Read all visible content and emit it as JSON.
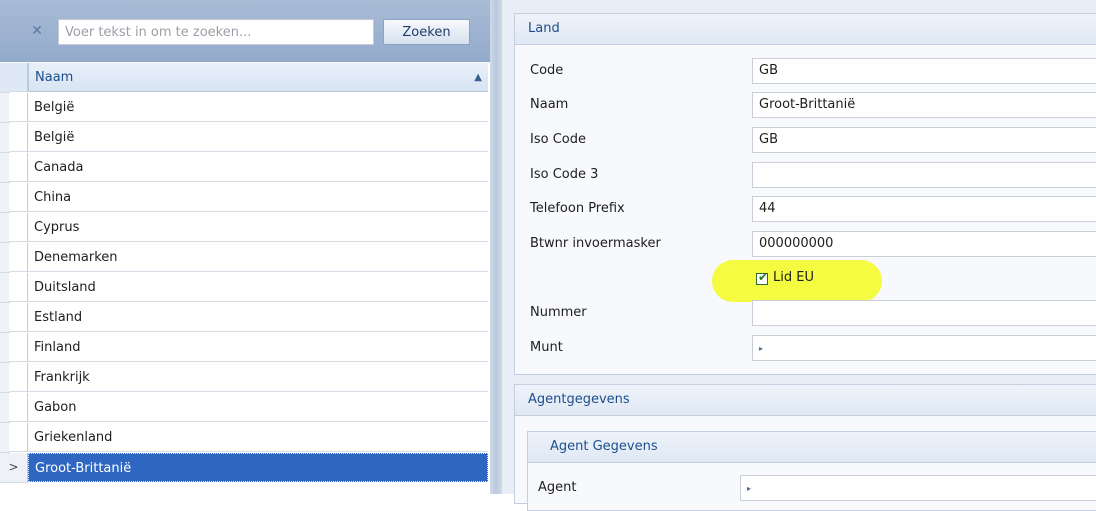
{
  "search": {
    "placeholder": "Voer tekst in om te zoeken...",
    "value": "",
    "clear_icon": "✕",
    "button_label": "Zoeken"
  },
  "grid": {
    "column_header": "Naam",
    "sort_icon": "▲",
    "selected_marker": ">",
    "rows": [
      "België",
      "België",
      "Canada",
      "China",
      "Cyprus",
      "Denemarken",
      "Duitsland",
      "Estland",
      "Finland",
      "Frankrijk",
      "Gabon",
      "Griekenland",
      "Groot-Brittanië"
    ],
    "selected_row": "Groot-Brittanië"
  },
  "land": {
    "title": "Land",
    "fields": {
      "code": {
        "label": "Code",
        "value": "GB"
      },
      "naam": {
        "label": "Naam",
        "value": "Groot-Brittanië"
      },
      "iso_code": {
        "label": "Iso Code",
        "value": "GB"
      },
      "iso_code3": {
        "label": "Iso Code 3",
        "value": ""
      },
      "telefoon": {
        "label": "Telefoon Prefix",
        "value": "44"
      },
      "btwnr": {
        "label": "Btwnr invoermasker",
        "value": "000000000"
      },
      "nummer": {
        "label": "Nummer",
        "value": ""
      },
      "munt": {
        "label": "Munt",
        "value": ""
      }
    },
    "lid_eu": {
      "label": "Lid EU",
      "checked": true
    },
    "lookup_arrow": "▸",
    "highlight_color": "#f3fb2b"
  },
  "agent": {
    "title": "Agentgegevens",
    "sub_title": "Agent Gegevens",
    "field_label": "Agent",
    "lookup_arrow": "▸"
  }
}
